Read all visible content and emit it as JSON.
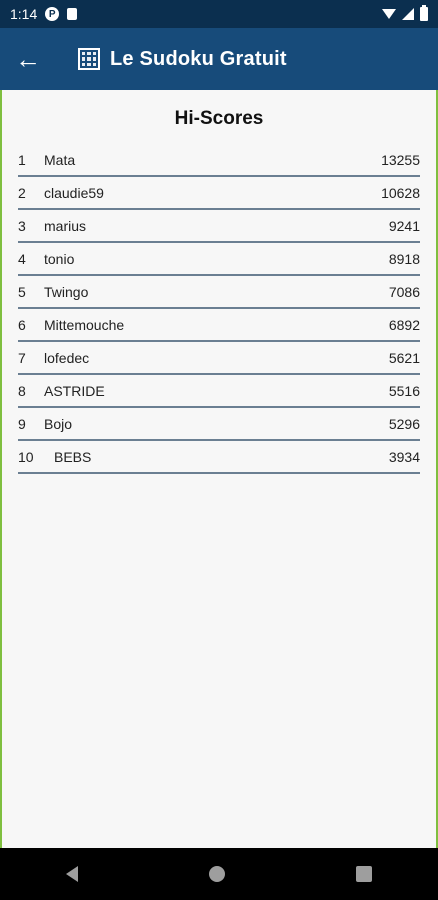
{
  "status_bar": {
    "time": "1:14",
    "badge_letter": "P",
    "icons": [
      "wifi-icon",
      "cellular-icon",
      "battery-icon"
    ]
  },
  "app_bar": {
    "back_icon": "←",
    "title": "Le Sudoku Gratuit",
    "background": "#174b7a"
  },
  "scores": {
    "heading": "Hi-Scores",
    "rows": [
      {
        "rank": "1",
        "name": "Mata",
        "score": "13255"
      },
      {
        "rank": "2",
        "name": "claudie59",
        "score": "10628"
      },
      {
        "rank": "3",
        "name": "marius",
        "score": "9241"
      },
      {
        "rank": "4",
        "name": "tonio",
        "score": "8918"
      },
      {
        "rank": "5",
        "name": "Twingo",
        "score": "7086"
      },
      {
        "rank": "6",
        "name": "Mittemouche",
        "score": "6892"
      },
      {
        "rank": "7",
        "name": "lofedec",
        "score": "5621"
      },
      {
        "rank": "8",
        "name": "ASTRIDE",
        "score": "5516"
      },
      {
        "rank": "9",
        "name": "Bojo",
        "score": "5296"
      },
      {
        "rank": "10",
        "name": "BEBS",
        "score": "3934"
      }
    ]
  },
  "nav_bar": {
    "buttons": [
      "back-triangle-icon",
      "home-circle-icon",
      "recent-square-icon"
    ]
  }
}
